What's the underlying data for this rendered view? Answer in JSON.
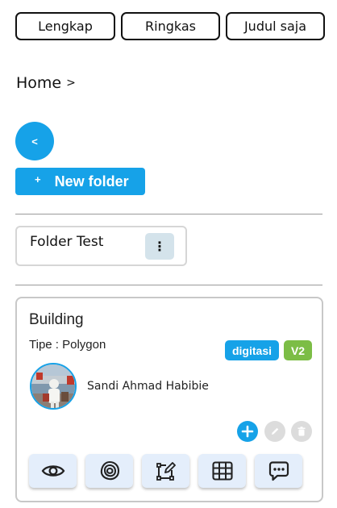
{
  "view_modes": [
    "Lengkap",
    "Ringkas",
    "Judul saja"
  ],
  "breadcrumb": {
    "home": "Home",
    "separator": ">"
  },
  "back_button": {
    "label": "<"
  },
  "new_folder_button": {
    "icon": "+",
    "label": "New folder"
  },
  "folder": {
    "name": "Folder Test",
    "menu_icon": "⋮"
  },
  "layer": {
    "title": "Building",
    "type_text": "Tipe : Polygon",
    "badges": [
      "digitasi",
      "V2"
    ],
    "owner": "Sandi Ahmad Habibie",
    "mini_actions": [
      "add-icon",
      "edit-icon",
      "delete-icon"
    ],
    "actions": [
      "eye-icon",
      "layers-icon",
      "edit-polygon-icon",
      "table-icon",
      "chat-icon"
    ]
  },
  "colors": {
    "accent": "#16a2e8",
    "version_badge": "#7cbd46",
    "action_bg": "#e4eefb"
  }
}
